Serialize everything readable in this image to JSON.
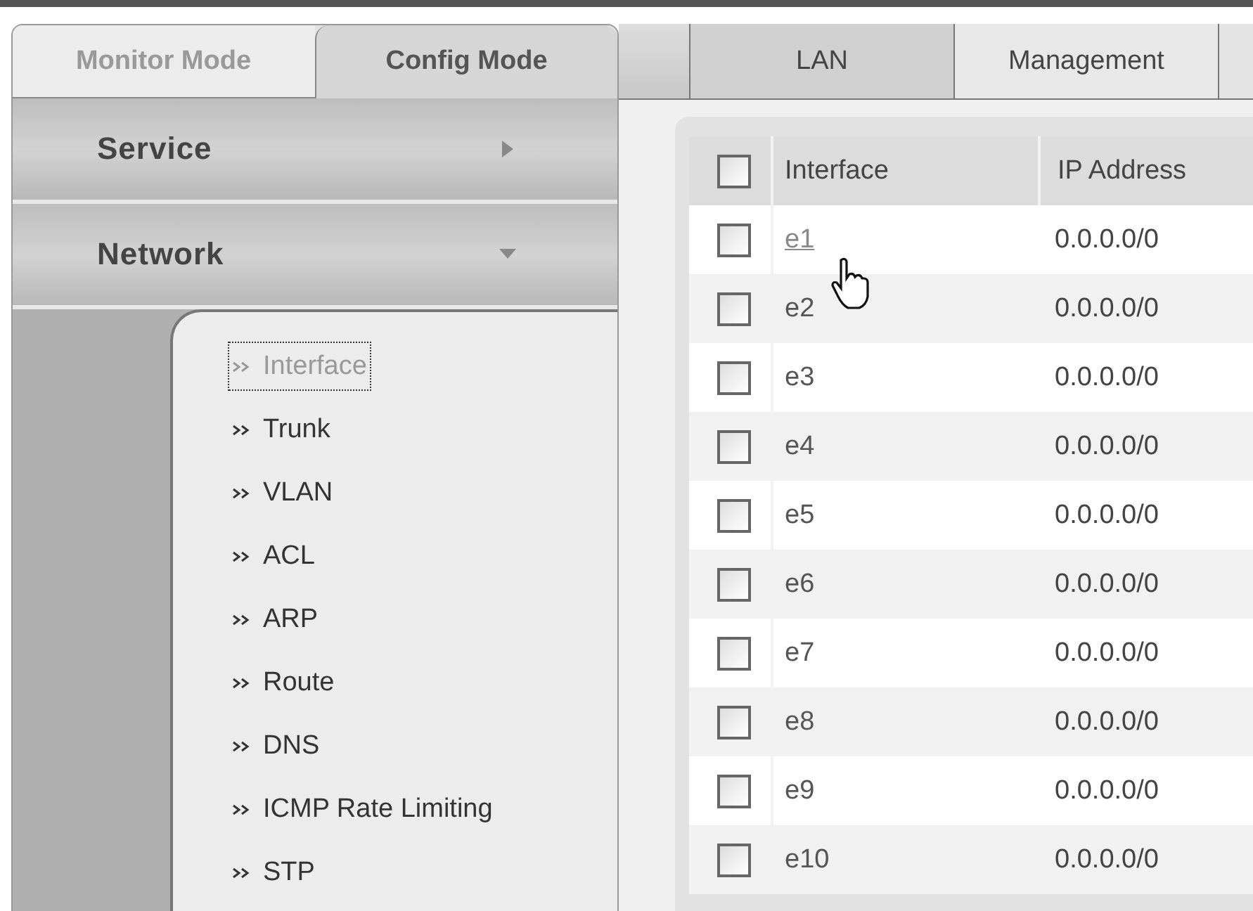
{
  "mode_tabs": [
    {
      "label": "Monitor Mode",
      "selected": false
    },
    {
      "label": "Config Mode",
      "selected": true
    }
  ],
  "sections": [
    {
      "label": "Service",
      "expanded": false
    },
    {
      "label": "Network",
      "expanded": true,
      "items": [
        {
          "label": "Interface",
          "selected": true
        },
        {
          "label": "Trunk",
          "selected": false
        },
        {
          "label": "VLAN",
          "selected": false
        },
        {
          "label": "ACL",
          "selected": false
        },
        {
          "label": "ARP",
          "selected": false
        },
        {
          "label": "Route",
          "selected": false
        },
        {
          "label": "DNS",
          "selected": false
        },
        {
          "label": "ICMP Rate Limiting",
          "selected": false
        },
        {
          "label": "STP",
          "selected": false
        }
      ]
    }
  ],
  "top_tabs": [
    {
      "label": "LAN",
      "selected": true
    },
    {
      "label": "Management",
      "selected": false
    }
  ],
  "table": {
    "header_checked": false,
    "columns": [
      "Interface",
      "IP Address"
    ],
    "rows": [
      {
        "checked": false,
        "interface": "e1",
        "link": true,
        "ip": "0.0.0.0/0"
      },
      {
        "checked": false,
        "interface": "e2",
        "link": false,
        "ip": "0.0.0.0/0"
      },
      {
        "checked": false,
        "interface": "e3",
        "link": false,
        "ip": "0.0.0.0/0"
      },
      {
        "checked": false,
        "interface": "e4",
        "link": false,
        "ip": "0.0.0.0/0"
      },
      {
        "checked": false,
        "interface": "e5",
        "link": false,
        "ip": "0.0.0.0/0"
      },
      {
        "checked": false,
        "interface": "e6",
        "link": false,
        "ip": "0.0.0.0/0"
      },
      {
        "checked": false,
        "interface": "e7",
        "link": false,
        "ip": "0.0.0.0/0"
      },
      {
        "checked": false,
        "interface": "e8",
        "link": false,
        "ip": "0.0.0.0/0"
      },
      {
        "checked": false,
        "interface": "e9",
        "link": false,
        "ip": "0.0.0.0/0"
      },
      {
        "checked": false,
        "interface": "e10",
        "link": false,
        "ip": "0.0.0.0/0"
      }
    ]
  }
}
